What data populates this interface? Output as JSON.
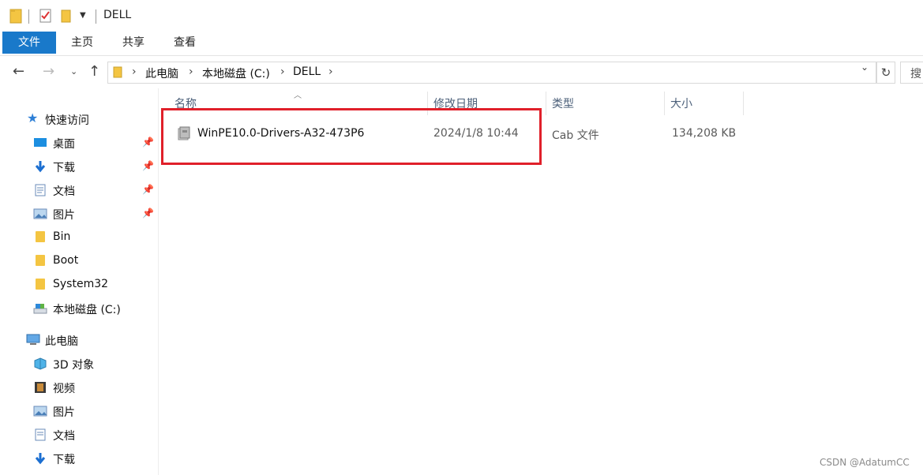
{
  "window": {
    "title": "DELL"
  },
  "ribbon": {
    "tabs": [
      "文件",
      "主页",
      "共享",
      "查看"
    ]
  },
  "address": {
    "crumbs": [
      "此电脑",
      "本地磁盘 (C:)",
      "DELL"
    ],
    "search_placeholder": "搜"
  },
  "sidebar": {
    "quick_access": "快速访问",
    "quick_items": [
      {
        "label": "桌面",
        "icon": "desktop-icon",
        "pinned": true
      },
      {
        "label": "下载",
        "icon": "download-icon",
        "pinned": true
      },
      {
        "label": "文档",
        "icon": "document-icon",
        "pinned": true
      },
      {
        "label": "图片",
        "icon": "pictures-icon",
        "pinned": true
      },
      {
        "label": "Bin",
        "icon": "folder-icon"
      },
      {
        "label": "Boot",
        "icon": "folder-icon"
      },
      {
        "label": "System32",
        "icon": "folder-icon"
      },
      {
        "label": "本地磁盘 (C:)",
        "icon": "drive-icon"
      }
    ],
    "this_pc": "此电脑",
    "pc_items": [
      {
        "label": "3D 对象",
        "icon": "3d-objects-icon"
      },
      {
        "label": "视频",
        "icon": "videos-icon"
      },
      {
        "label": "图片",
        "icon": "pictures-icon"
      },
      {
        "label": "文档",
        "icon": "document-icon"
      },
      {
        "label": "下载",
        "icon": "download-icon"
      }
    ]
  },
  "file_list": {
    "columns": [
      "名称",
      "修改日期",
      "类型",
      "大小"
    ],
    "rows": [
      {
        "name": "WinPE10.0-Drivers-A32-473P6",
        "modified": "2024/1/8 10:44",
        "type": "Cab 文件",
        "size": "134,208 KB"
      }
    ]
  },
  "watermark": "CSDN @AdatumCC",
  "colors": {
    "accent": "#1979ca",
    "highlight": "#e0202a",
    "folder": "#f4c542"
  }
}
